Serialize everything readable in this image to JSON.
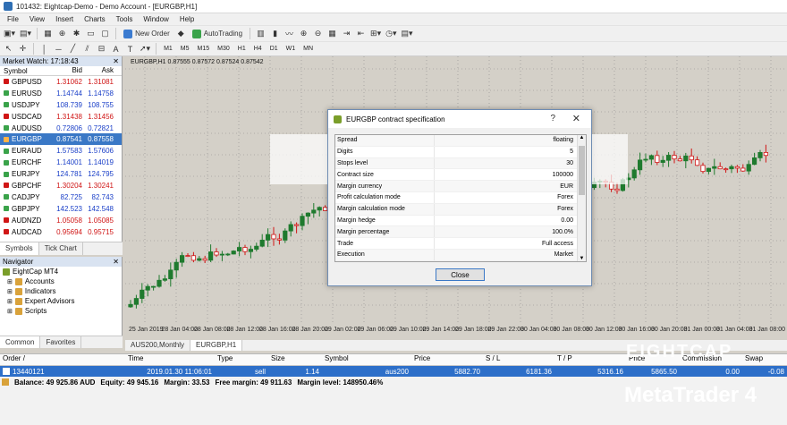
{
  "window": {
    "title": "101432: Eightcap-Demo - Demo Account - [EURGBP,H1]"
  },
  "menu": [
    "File",
    "View",
    "Insert",
    "Charts",
    "Tools",
    "Window",
    "Help"
  ],
  "toolbar": {
    "new_order": "New Order",
    "autotrading": "AutoTrading"
  },
  "timeframes": [
    "M1",
    "M5",
    "M15",
    "M30",
    "H1",
    "H4",
    "D1",
    "W1",
    "MN"
  ],
  "market_watch": {
    "title": "Market Watch: 17:18:43",
    "headers": {
      "symbol": "Symbol",
      "bid": "Bid",
      "ask": "Ask"
    },
    "rows": [
      {
        "symbol": "GBPUSD",
        "bid": "1.31062",
        "ask": "1.31081",
        "color": "red"
      },
      {
        "symbol": "EURUSD",
        "bid": "1.14744",
        "ask": "1.14758",
        "color": "blue"
      },
      {
        "symbol": "USDJPY",
        "bid": "108.739",
        "ask": "108.755",
        "color": "blue"
      },
      {
        "symbol": "USDCAD",
        "bid": "1.31438",
        "ask": "1.31456",
        "color": "red"
      },
      {
        "symbol": "AUDUSD",
        "bid": "0.72806",
        "ask": "0.72821",
        "color": "blue"
      },
      {
        "symbol": "EURGBP",
        "bid": "0.87541",
        "ask": "0.87558",
        "color": "sel"
      },
      {
        "symbol": "EURAUD",
        "bid": "1.57583",
        "ask": "1.57606",
        "color": "blue"
      },
      {
        "symbol": "EURCHF",
        "bid": "1.14001",
        "ask": "1.14019",
        "color": "blue"
      },
      {
        "symbol": "EURJPY",
        "bid": "124.781",
        "ask": "124.795",
        "color": "blue"
      },
      {
        "symbol": "GBPCHF",
        "bid": "1.30204",
        "ask": "1.30241",
        "color": "red"
      },
      {
        "symbol": "CADJPY",
        "bid": "82.725",
        "ask": "82.743",
        "color": "blue"
      },
      {
        "symbol": "GBPJPY",
        "bid": "142.523",
        "ask": "142.548",
        "color": "blue"
      },
      {
        "symbol": "AUDNZD",
        "bid": "1.05058",
        "ask": "1.05085",
        "color": "red"
      },
      {
        "symbol": "AUDCAD",
        "bid": "0.95694",
        "ask": "0.95715",
        "color": "red"
      }
    ],
    "tabs": [
      "Symbols",
      "Tick Chart"
    ]
  },
  "navigator": {
    "title": "Navigator",
    "items": [
      "EightCap MT4",
      "Accounts",
      "Indicators",
      "Expert Advisors",
      "Scripts"
    ],
    "tabs": [
      "Common",
      "Favorites"
    ]
  },
  "chart": {
    "label": "EURGBP,H1 0.87555 0.87572 0.87524 0.87542",
    "x_ticks": [
      "25 Jan 2019",
      "28 Jan 04:00",
      "28 Jan 08:00",
      "28 Jan 12:00",
      "28 Jan 16:00",
      "28 Jan 20:00",
      "29 Jan 02:00",
      "29 Jan 06:00",
      "29 Jan 10:00",
      "29 Jan 14:00",
      "29 Jan 18:00",
      "29 Jan 22:00",
      "30 Jan 04:00",
      "30 Jan 08:00",
      "30 Jan 12:00",
      "30 Jan 16:00",
      "30 Jan 20:00",
      "31 Jan 00:00",
      "31 Jan 04:00",
      "31 Jan 08:00"
    ],
    "tabs": [
      "AUS200,Monthly",
      "EURGBP,H1"
    ]
  },
  "dialog": {
    "title": "EURGBP contract specification",
    "help": "?",
    "close_icon": "✕",
    "rows": [
      {
        "k": "Spread",
        "v": "floating"
      },
      {
        "k": "Digits",
        "v": "5"
      },
      {
        "k": "Stops level",
        "v": "30"
      },
      {
        "k": "Contract size",
        "v": "100000"
      },
      {
        "k": "Margin currency",
        "v": "EUR"
      },
      {
        "k": "Profit calculation mode",
        "v": "Forex"
      },
      {
        "k": "Margin calculation mode",
        "v": "Forex"
      },
      {
        "k": "Margin hedge",
        "v": "0.00"
      },
      {
        "k": "Margin percentage",
        "v": "100.0%"
      },
      {
        "k": "Trade",
        "v": "Full access"
      },
      {
        "k": "Execution",
        "v": "Market"
      }
    ],
    "close_button": "Close"
  },
  "terminal": {
    "headers": [
      "Order",
      "/",
      "Time",
      "Type",
      "Size",
      "Symbol",
      "Price",
      "S / L",
      "T / P",
      "Price",
      "Commission",
      "Swap"
    ],
    "row": {
      "order": "13440121",
      "time": "2019.01.30 11:06:01",
      "type": "sell",
      "size": "1.14",
      "symbol": "aus200",
      "price": "5882.70",
      "sl": "6181.36",
      "tp": "5316.16",
      "cur_price": "5865.50",
      "commission": "0.00",
      "swap": "-0.08"
    },
    "balance": {
      "balance": "Balance: 49 925.86 AUD",
      "equity": "Equity: 49 945.16",
      "margin": "Margin: 33.53",
      "free": "Free margin: 49 911.63",
      "level": "Margin level: 148950.46%"
    }
  },
  "watermark": {
    "top": "EIGHTCAP",
    "bottom": "MetaTrader 4"
  },
  "colors": {
    "bull": "#1f7a2e",
    "bear": "#d01616",
    "grid": "#8a8a8a"
  }
}
